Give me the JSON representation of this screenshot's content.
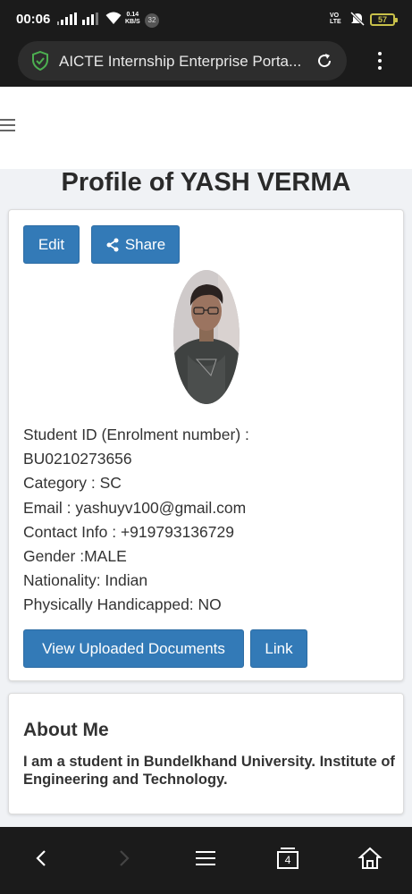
{
  "status_bar": {
    "time": "00:06",
    "network_speed_value": "0.14",
    "network_speed_unit": "KB/S",
    "notification_count": "32",
    "volte_line1": "VO",
    "volte_line2": "LTE",
    "battery_level": "57",
    "icons": [
      "signal-icon",
      "wifi-icon",
      "mute-icon",
      "battery-icon"
    ]
  },
  "browser": {
    "page_title": "AICTE Internship Enterprise Porta...",
    "icons": [
      "secure-shield-icon",
      "reload-icon",
      "more-menu-icon"
    ],
    "accent_color": "#4caf50"
  },
  "page": {
    "menu_icon": "hamburger-icon",
    "title": "Profile of YASH VERMA",
    "buttons": {
      "edit": "Edit",
      "share": "Share",
      "view_documents": "View Uploaded Documents",
      "link": "Link"
    },
    "avatar_alt": "profile-photo",
    "info": [
      "Student ID (Enrolment number) :",
      "BU0210273656",
      "Category : SC",
      "Email : yashuyv100@gmail.com",
      "Contact Info : +919793136729",
      "Gender :MALE",
      "Nationality: Indian",
      "Physically Handicapped: NO"
    ],
    "about": {
      "heading": "About Me",
      "text": "I am a student in Bundelkhand University. Institute of Engineering and Technology."
    },
    "colors": {
      "button_primary": "#337ab7",
      "page_background": "#f0f2f5"
    }
  },
  "nav_bar": {
    "tabs_count": "4",
    "items": [
      "back-icon",
      "forward-icon",
      "menu-icon",
      "tabs-icon",
      "home-icon"
    ]
  }
}
